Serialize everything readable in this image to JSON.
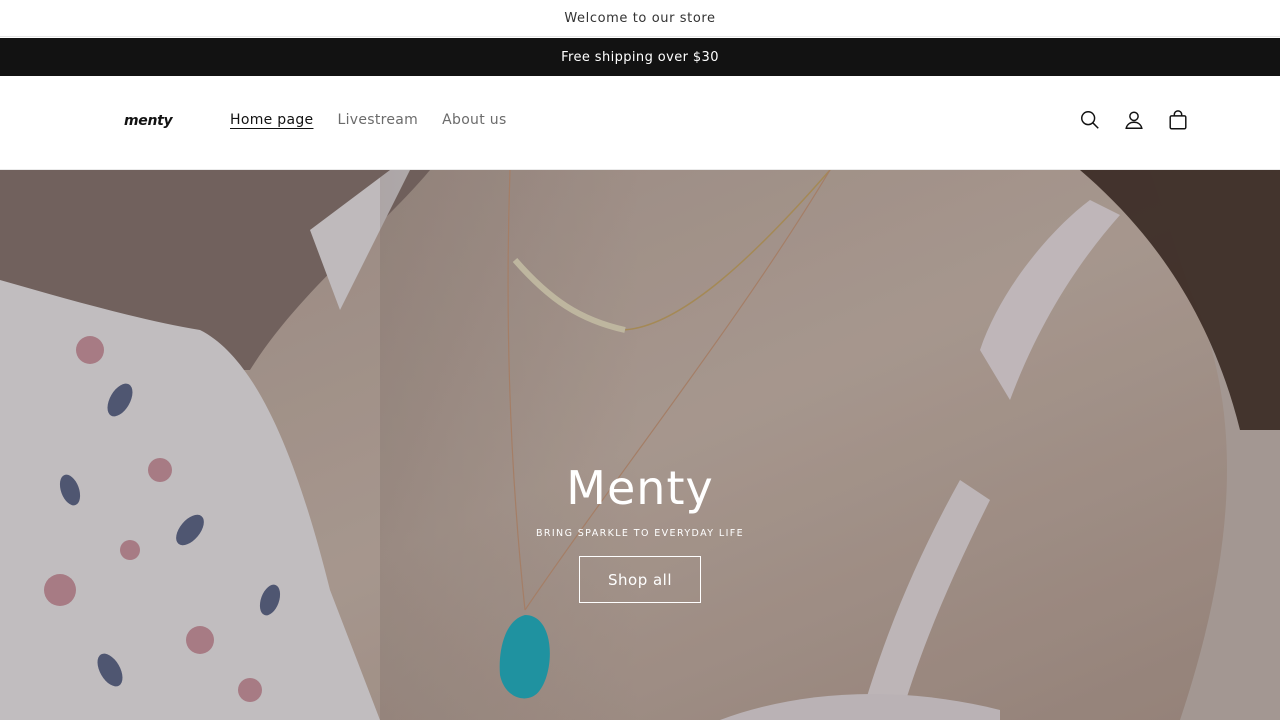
{
  "announcement": {
    "welcome_text": "Welcome to our store",
    "shipping_text": "Free shipping over $30"
  },
  "header": {
    "logo_text": "menty",
    "nav": [
      {
        "label": "Home page",
        "active": true
      },
      {
        "label": "Livestream",
        "active": false
      },
      {
        "label": "About us",
        "active": false
      }
    ],
    "icons": [
      "search-icon",
      "account-icon",
      "cart-icon"
    ]
  },
  "hero": {
    "title": "Menty",
    "subtitle": "BRING SPARKLE TO EVERYDAY LIFE",
    "button_label": "Shop all"
  },
  "colors": {
    "shipping_bar_bg": "#121212",
    "text_primary": "#121212",
    "nav_muted": "#6b6b6b",
    "pendant": "#27b3c4",
    "skin": "#c9b6ab"
  }
}
